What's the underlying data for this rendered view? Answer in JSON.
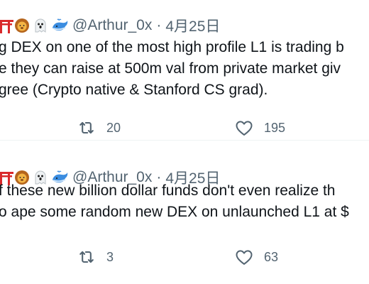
{
  "tweets": [
    {
      "handle": "@Arthur_0x",
      "separator": "·",
      "date": "4月25日",
      "lines": [
        "g DEX on one of the most high profile L1 is trading b",
        "e they can raise at 500m val from private market giv",
        "gree (Crypto native & Stanford CS grad)."
      ],
      "retweets": "20",
      "likes": "195"
    },
    {
      "handle": "@Arthur_0x",
      "separator": "·",
      "date": "4月25日",
      "lines": [
        "f these new billion dollar funds don't even realize th",
        "o ape some random new DEX on unlaunched L1 at $"
      ],
      "retweets": "3",
      "likes": "63"
    }
  ],
  "icons": {
    "name_emojis": [
      "torii-icon",
      "lion-face-icon",
      "ghost-icon",
      "whale-icon"
    ],
    "actions": [
      "retweet-icon",
      "heart-icon"
    ]
  },
  "colors": {
    "secondary_text": "#536471",
    "primary_text": "#0f1419",
    "divider": "#eff3f4"
  }
}
